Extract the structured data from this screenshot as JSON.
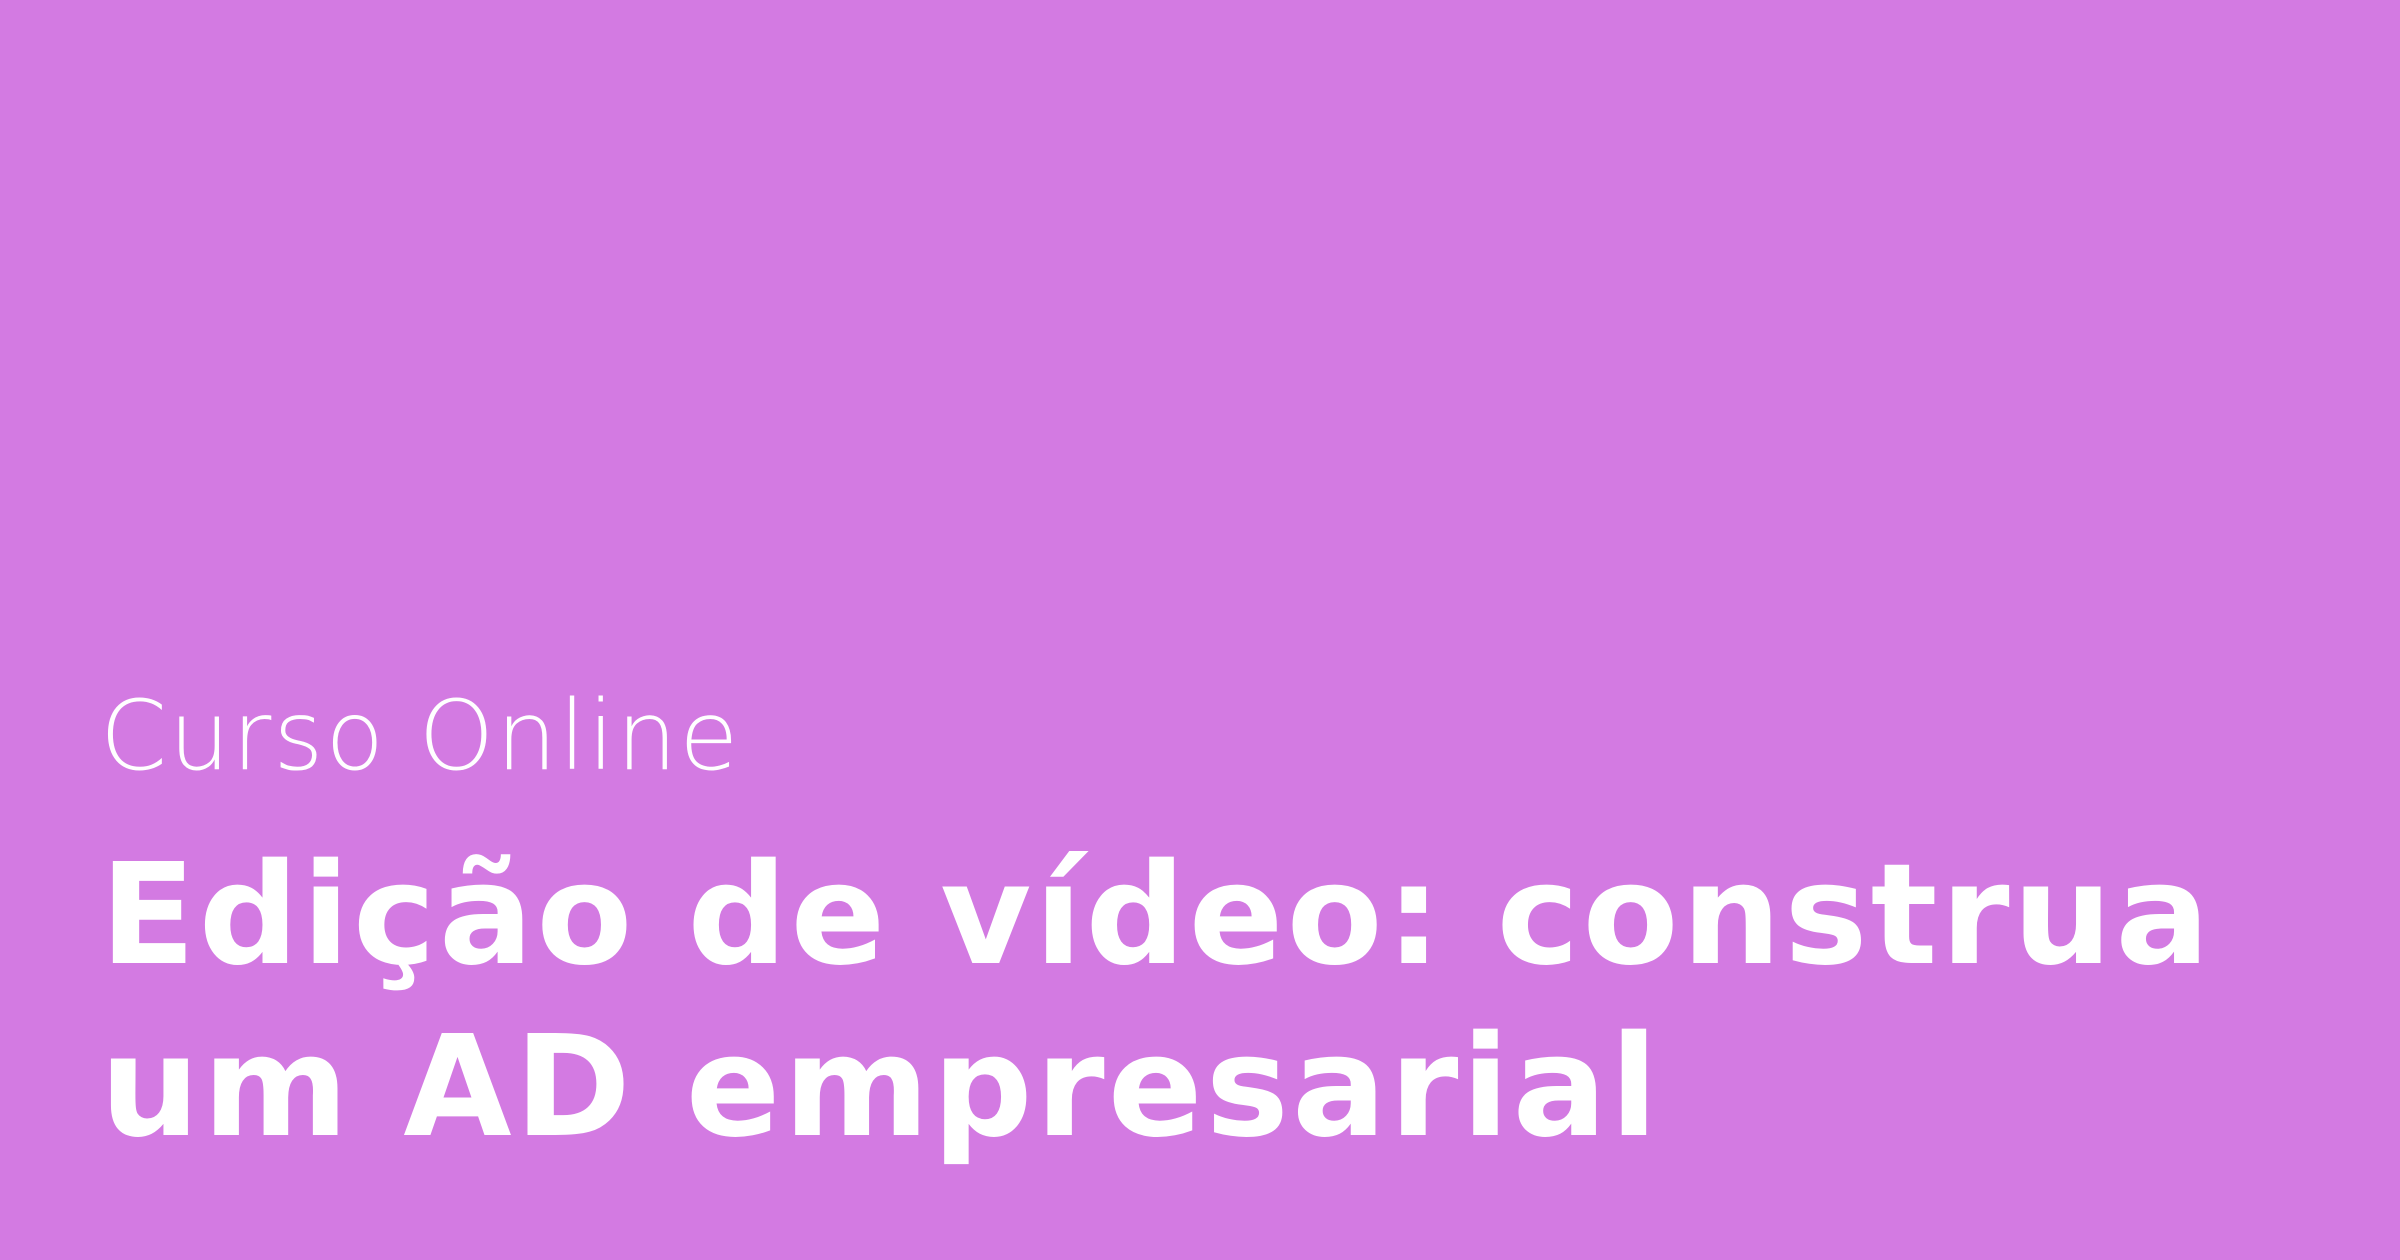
{
  "card": {
    "eyebrow": "Curso Online",
    "title_line1": "Edição de vídeo: construa",
    "title_line2": "um AD empresarial",
    "background_color": "#d37ae2",
    "text_color": "#ffffff"
  }
}
